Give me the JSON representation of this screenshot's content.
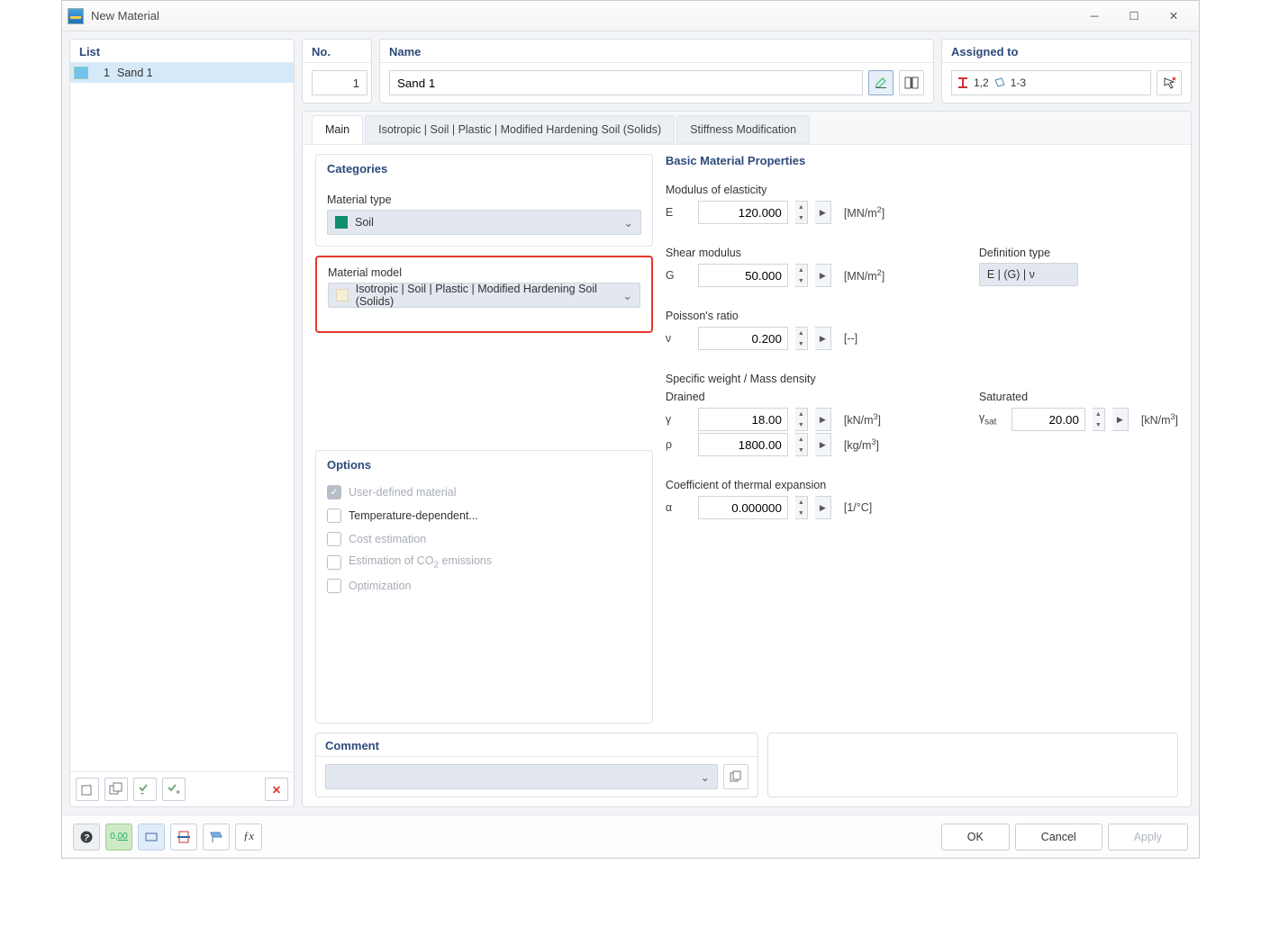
{
  "window": {
    "title": "New Material"
  },
  "list": {
    "title": "List",
    "items": [
      {
        "num": "1",
        "name": "Sand 1"
      }
    ]
  },
  "header": {
    "no_label": "No.",
    "no_value": "1",
    "name_label": "Name",
    "name_value": "Sand 1",
    "assigned_label": "Assigned to",
    "assigned_a": "1,2",
    "assigned_b": "1-3"
  },
  "tabs": {
    "main": "Main",
    "t2": "Isotropic | Soil | Plastic | Modified Hardening Soil (Solids)",
    "t3": "Stiffness Modification"
  },
  "categories": {
    "title": "Categories",
    "type_label": "Material type",
    "type_value": "Soil",
    "model_label": "Material model",
    "model_value": "Isotropic | Soil | Plastic | Modified Hardening Soil (Solids)"
  },
  "options": {
    "title": "Options",
    "user": "User-defined material",
    "temp": "Temperature-dependent...",
    "cost": "Cost estimation",
    "co2a": "Estimation of CO",
    "co2b": " emissions",
    "opt": "Optimization"
  },
  "props": {
    "title": "Basic Material Properties",
    "E_label": "Modulus of elasticity",
    "E_sym": "E",
    "E_val": "120.000",
    "E_unit": "[MN/m",
    "sq": "2",
    "br": "]",
    "G_label": "Shear modulus",
    "G_sym": "G",
    "G_val": "50.000",
    "def_label": "Definition type",
    "def_val": "E | (G) | ν",
    "nu_label": "Poisson's ratio",
    "nu_sym": "ν",
    "nu_val": "0.200",
    "nu_unit": "[--]",
    "sw_label": "Specific weight / Mass density",
    "drained": "Drained",
    "saturated": "Saturated",
    "g_sym": "γ",
    "g_val": "18.00",
    "g_unit": "[kN/m",
    "cu": "3",
    "gsat_sym": "γ",
    "gsat_sub": "sat",
    "gsat_val": "20.00",
    "rho_sym": "ρ",
    "rho_val": "1800.00",
    "rho_unit": "[kg/m",
    "alpha_label": "Coefficient of thermal expansion",
    "alpha_sym": "α",
    "alpha_val": "0.000000",
    "alpha_unit": "[1/°C]"
  },
  "comment": {
    "title": "Comment"
  },
  "footer": {
    "ok": "OK",
    "cancel": "Cancel",
    "apply": "Apply"
  }
}
